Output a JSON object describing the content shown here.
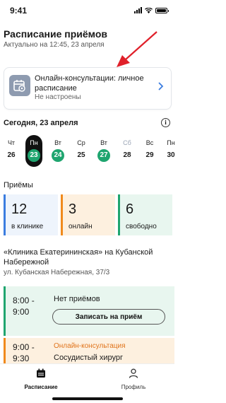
{
  "status_bar": {
    "time": "9:41"
  },
  "header": {
    "title": "Расписание приёмов",
    "subtitle": "Актуально на 12:45, 23 апреля"
  },
  "consult_card": {
    "title": "Онлайн-консультации: личное расписание",
    "status": "Не настроены",
    "icon": "calendar-settings-icon"
  },
  "date_strip": {
    "label": "Сегодня, 23 апреля",
    "days": [
      {
        "name": "Чт",
        "num": "26",
        "state": "plain"
      },
      {
        "name": "Пн",
        "num": "23",
        "state": "selected"
      },
      {
        "name": "Вт",
        "num": "24",
        "state": "available"
      },
      {
        "name": "Ср",
        "num": "25",
        "state": "plain"
      },
      {
        "name": "Вт",
        "num": "27",
        "state": "available"
      },
      {
        "name": "Сб",
        "num": "28",
        "state": "weekend"
      },
      {
        "name": "Вс",
        "num": "29",
        "state": "plain"
      },
      {
        "name": "Пн",
        "num": "30",
        "state": "plain"
      }
    ]
  },
  "appointments": {
    "label": "Приёмы",
    "stats": [
      {
        "num": "12",
        "label": "в клинике"
      },
      {
        "num": "3",
        "label": "онлайн"
      },
      {
        "num": "6",
        "label": "свободно"
      }
    ]
  },
  "clinic": {
    "name": "«Клиника Екатерининская» на Кубанской Набережной",
    "address": "ул. Кубанская Набережная, 37/3"
  },
  "slots": [
    {
      "time_from": "8:00 -",
      "time_to": "9:00",
      "text": "Нет приёмов",
      "button": "Записать на приём"
    },
    {
      "time_from": "9:00 -",
      "time_to": "9:30",
      "kind": "Онлайн-консультация",
      "doctor": "Сосудистый хирург"
    }
  ],
  "tabbar": {
    "schedule": "Расписание",
    "profile": "Профиль"
  },
  "colors": {
    "green": "#1fa56f",
    "orange": "#f08a1c",
    "blue": "#3b7de0",
    "arrow": "#e0202a"
  }
}
